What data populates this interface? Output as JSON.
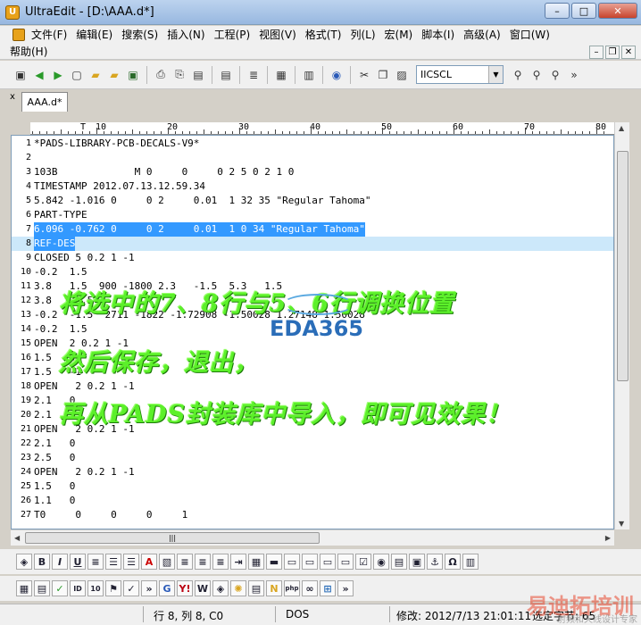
{
  "window": {
    "title": "UltraEdit - [D:\\AAA.d*]",
    "minimize": "–",
    "maximize": "□",
    "close": "✕"
  },
  "menu": {
    "items": [
      "文件(F)",
      "编辑(E)",
      "搜索(S)",
      "插入(N)",
      "工程(P)",
      "视图(V)",
      "格式(T)",
      "列(L)",
      "宏(M)",
      "脚本(I)",
      "高级(A)",
      "窗口(W)"
    ],
    "help": "帮助(H)"
  },
  "toolbar": {
    "font_combo": "IICSCL"
  },
  "tab": {
    "label": "AAA.d*",
    "close": "x"
  },
  "ruler": [
    "T",
    "10",
    "20",
    "30",
    "40",
    "50",
    "60",
    "70",
    "80"
  ],
  "editor": {
    "lines": [
      {
        "n": "1",
        "t": "*PADS-LIBRARY-PCB-DECALS-V9*"
      },
      {
        "n": "2",
        "t": ""
      },
      {
        "n": "3",
        "t": "103B             M 0     0     0 2 5 0 2 1 0"
      },
      {
        "n": "4",
        "t": "TIMESTAMP 2012.07.13.12.59.34"
      },
      {
        "n": "5",
        "t": "5.842 -1.016 0     0 2     0.01  1 32 35 \"Regular Tahoma\""
      },
      {
        "n": "6",
        "t": "PART-TYPE"
      },
      {
        "n": "7",
        "t": "6.096 -0.762 0     0 2     0.01  1 0 34 \"Regular Tahoma\""
      },
      {
        "n": "8",
        "t": "REF-DES"
      },
      {
        "n": "9",
        "t": "CLOSED 5 0.2 1 -1"
      },
      {
        "n": "10",
        "t": "-0.2  1.5"
      },
      {
        "n": "11",
        "t": "3.8   1.5  900 -1800 2.3   -1.5  5.3   1.5"
      },
      {
        "n": "12",
        "t": "3.8   -1.5"
      },
      {
        "n": "13",
        "t": "-0.2  -1.5  2711 -1822 -1.72908 -1.50028 1.27148 1.50028"
      },
      {
        "n": "14",
        "t": "-0.2  1.5"
      },
      {
        "n": "15",
        "t": "OPEN  2 0.2 1 -1"
      },
      {
        "n": "16",
        "t": "1.5   0"
      },
      {
        "n": "17",
        "t": "1.5   -1"
      },
      {
        "n": "18",
        "t": "OPEN   2 0.2 1 -1"
      },
      {
        "n": "19",
        "t": "2.1   0"
      },
      {
        "n": "20",
        "t": "2.1   1"
      },
      {
        "n": "21",
        "t": "OPEN   2 0.2 1 -1"
      },
      {
        "n": "22",
        "t": "2.1   0"
      },
      {
        "n": "23",
        "t": "2.5   0"
      },
      {
        "n": "24",
        "t": "OPEN   2 0.2 1 -1"
      },
      {
        "n": "25",
        "t": "1.5   0"
      },
      {
        "n": "26",
        "t": "1.1   0"
      },
      {
        "n": "27",
        "t": "T0     0     0     0     1"
      }
    ]
  },
  "overlay": {
    "line1": "将选中的7、8行与5、6行调换位置",
    "line2": "然后保存，退出，",
    "line3": "再从PADS封装库中导入，即可见效果！"
  },
  "watermark": {
    "text": "EDA365"
  },
  "status": {
    "position": "行 8, 列 8, C0",
    "format": "DOS",
    "modified": "修改: 2012/7/13 21:01:11",
    "selected": "选定字节: 65"
  },
  "brand": {
    "main": "易迪拓培训",
    "sub": "射频和天线设计专家"
  },
  "colors": {
    "selection": "#3399ff",
    "current_line": "#cce8fa",
    "overlay_text": "#5cf02a"
  }
}
